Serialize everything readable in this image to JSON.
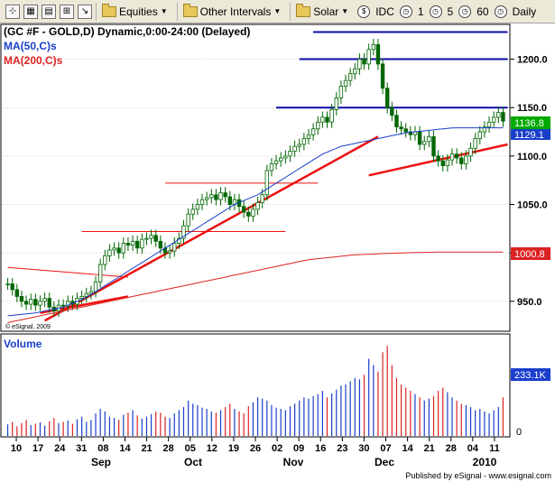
{
  "toolbar": {
    "equities_label": "Equities",
    "intervals_label": "Other Intervals",
    "solar_label": "Solar",
    "idc_label": "IDC",
    "interval_1": "1",
    "interval_5": "5",
    "interval_60": "60",
    "daily_label": "Daily"
  },
  "chart_header": {
    "symbol_line": "(GC #F - GOLD,D) Dynamic,0:00-24:00 (Delayed)",
    "ma50_label": "MA(50,C)s",
    "ma200_label": "MA(200,C)s",
    "copyright": "© eSignal, 2009"
  },
  "colors": {
    "ma50": "#1a3fcc",
    "ma200": "#dd2222",
    "trend": "#ee1111",
    "resistance": "#0a0aaa",
    "price": "#006600",
    "last_price_bg": "#00aa00",
    "ma_price_bg": "#1a3fcc",
    "ma200_bg": "#dd2222",
    "volume_bg": "#1a3fcc"
  },
  "price_panel": {
    "y_ticks": [
      "1200.0",
      "1150.0",
      "1100.0",
      "1050.0",
      "1000.0",
      "950.0"
    ],
    "last_price": "1136.8",
    "ma50_value": "1129.1",
    "ma200_value": "1000.8"
  },
  "volume_panel": {
    "label": "Volume",
    "value": "233.1K",
    "y_tick": "0"
  },
  "x_axis": {
    "day_labels": [
      "10",
      "17",
      "24",
      "31",
      "08",
      "14",
      "21",
      "28",
      "05",
      "12",
      "19",
      "26",
      "02",
      "09",
      "16",
      "23",
      "30",
      "07",
      "14",
      "21",
      "28",
      "04",
      "11"
    ],
    "month_labels": [
      "Sep",
      "Oct",
      "Nov",
      "Dec",
      "2010"
    ]
  },
  "footer": "Published by eSignal - www.esignal.com",
  "chart_data": {
    "type": "candlestick",
    "ylim": [
      920,
      1235
    ],
    "close": [
      968,
      962,
      955,
      950,
      947,
      952,
      946,
      950,
      953,
      944,
      940,
      946,
      945,
      950,
      947,
      953,
      955,
      958,
      960,
      970,
      988,
      997,
      1003,
      1005,
      1000,
      1010,
      1008,
      1012,
      1005,
      1014,
      1015,
      1018,
      1012,
      1005,
      1000,
      1002,
      1010,
      1015,
      1028,
      1040,
      1045,
      1050,
      1055,
      1057,
      1060,
      1055,
      1062,
      1058,
      1050,
      1055,
      1048,
      1042,
      1038,
      1045,
      1052,
      1060,
      1085,
      1092,
      1095,
      1098,
      1100,
      1105,
      1110,
      1112,
      1118,
      1122,
      1128,
      1135,
      1140,
      1135,
      1148,
      1160,
      1172,
      1178,
      1185,
      1190,
      1200,
      1195,
      1210,
      1215,
      1195,
      1170,
      1150,
      1142,
      1130,
      1128,
      1125,
      1122,
      1125,
      1112,
      1115,
      1120,
      1100,
      1095,
      1090,
      1096,
      1102,
      1098,
      1092,
      1100,
      1108,
      1118,
      1125,
      1130,
      1135,
      1140,
      1145,
      1136
    ],
    "ma50": [
      935,
      935.5,
      936,
      936.5,
      937,
      937.5,
      938,
      939,
      940,
      941,
      942,
      943,
      944,
      946,
      948,
      950,
      952,
      954,
      957,
      960,
      963,
      966,
      969,
      972,
      975,
      978,
      981,
      984,
      987,
      990,
      993,
      996,
      999,
      1002,
      1005,
      1008,
      1011,
      1014,
      1017,
      1020,
      1023,
      1026,
      1029,
      1032,
      1035,
      1038,
      1041,
      1044,
      1047,
      1050,
      1052,
      1054,
      1056,
      1058,
      1060,
      1063,
      1066,
      1069,
      1072,
      1075,
      1078,
      1081,
      1084,
      1087,
      1090,
      1093,
      1096,
      1099,
      1102,
      1104,
      1106,
      1108,
      1110,
      1111,
      1112,
      1113,
      1114,
      1115,
      1116,
      1117,
      1118,
      1119,
      1120,
      1121,
      1122,
      1123,
      1124,
      1124.5,
      1125,
      1125.5,
      1126,
      1126.5,
      1127,
      1127.5,
      1128,
      1128.5,
      1129,
      1129.1,
      1129.1,
      1129.1,
      1129.1,
      1129.1,
      1129.1,
      1129.1,
      1129.1,
      1129.1,
      1129.1,
      1129.1
    ],
    "ma200": [
      928,
      929,
      930,
      931,
      932,
      933,
      934,
      935,
      936,
      937,
      938,
      939,
      940,
      941,
      942,
      943,
      944,
      945,
      946,
      947,
      948,
      949,
      950,
      951,
      952,
      953,
      954,
      955,
      956,
      957,
      958,
      959,
      960,
      961,
      962,
      963,
      964,
      965,
      966,
      967,
      968,
      969,
      970,
      971,
      972,
      973,
      974,
      975,
      976,
      977,
      978,
      979,
      980,
      981,
      982,
      983,
      984,
      985,
      986,
      987,
      988,
      989,
      990,
      991,
      992,
      993,
      993.5,
      994,
      994.5,
      995,
      995.5,
      996,
      996.5,
      997,
      997.5,
      998,
      998.2,
      998.4,
      998.6,
      998.8,
      999,
      999.2,
      999.4,
      999.6,
      999.8,
      1000,
      1000.1,
      1000.2,
      1000.3,
      1000.4,
      1000.5,
      1000.6,
      1000.7,
      1000.8,
      1000.8,
      1000.8,
      1000.8,
      1000.8,
      1000.8,
      1000.8,
      1000.8,
      1000.8,
      1000.8,
      1000.8,
      1000.8,
      1000.8,
      1000.8,
      1000.8
    ],
    "volume": [
      18,
      22,
      15,
      20,
      25,
      17,
      19,
      21,
      16,
      23,
      28,
      20,
      22,
      24,
      19,
      26,
      30,
      22,
      25,
      35,
      42,
      38,
      30,
      28,
      25,
      33,
      36,
      40,
      32,
      27,
      30,
      34,
      38,
      36,
      30,
      28,
      35,
      40,
      45,
      55,
      50,
      48,
      44,
      42,
      38,
      36,
      40,
      45,
      50,
      42,
      38,
      35,
      46,
      52,
      60,
      58,
      55,
      48,
      44,
      42,
      40,
      46,
      50,
      55,
      60,
      58,
      62,
      65,
      70,
      60,
      66,
      72,
      78,
      80,
      85,
      90,
      88,
      95,
      120,
      110,
      100,
      130,
      140,
      110,
      90,
      80,
      75,
      70,
      65,
      60,
      55,
      58,
      62,
      70,
      75,
      68,
      60,
      55,
      50,
      48,
      45,
      40,
      42,
      38,
      35,
      40,
      45,
      60
    ],
    "volume_max": 150,
    "support_lines": [
      {
        "y1": 985,
        "y2": 975,
        "x1i": 0,
        "x2i": 26
      },
      {
        "y1": 1022,
        "y2": 1022,
        "x1i": 16,
        "x2i": 60
      },
      {
        "y1": 1072,
        "y2": 1072,
        "x1i": 34,
        "x2i": 67
      }
    ],
    "trend_lines": [
      {
        "x1i": 7,
        "y1": 938,
        "x2i": 26,
        "y2": 955
      },
      {
        "x1i": 8,
        "y1": 930,
        "x2i": 80,
        "y2": 1120
      },
      {
        "x1i": 78,
        "y1": 1080,
        "x2i": 108,
        "y2": 1112
      }
    ],
    "resistance_lines": [
      {
        "y": 1228,
        "x1i": 66,
        "x2i": 108
      },
      {
        "y": 1200,
        "x1i": 63,
        "x2i": 108
      },
      {
        "y": 1150,
        "x1i": 58,
        "x2i": 108
      }
    ]
  }
}
